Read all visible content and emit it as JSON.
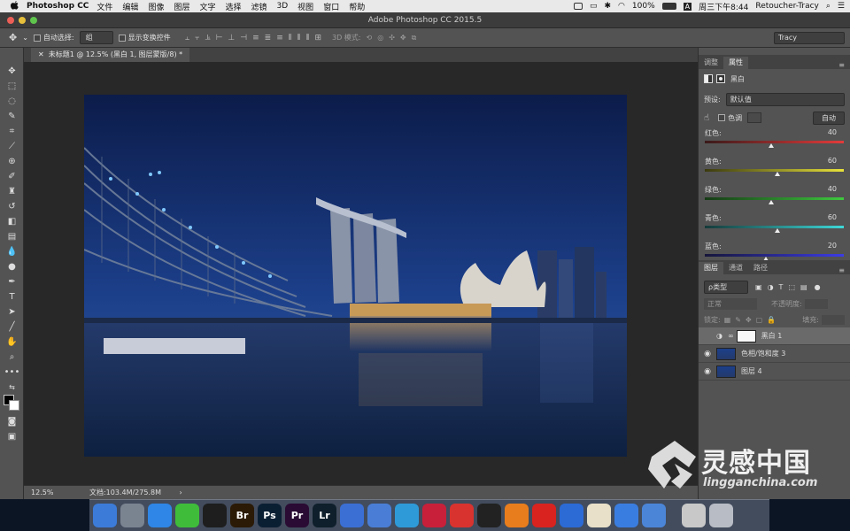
{
  "menubar": {
    "app_name": "Photoshop CC",
    "items": [
      "文件",
      "编辑",
      "图像",
      "图层",
      "文字",
      "选择",
      "滤镜",
      "3D",
      "视图",
      "窗口",
      "帮助"
    ],
    "battery": "100%",
    "input_method": "A",
    "datetime": "周三下午8:44",
    "user": "Retoucher-Tracy"
  },
  "window": {
    "title": "Adobe Photoshop CC 2015.5"
  },
  "options": {
    "auto_select_label": "自动选择:",
    "auto_select_value": "组",
    "show_transform_label": "显示变换控件",
    "mode_3d_label": "3D 模式:",
    "workspace": "Tracy"
  },
  "document": {
    "tab_title": "未标题1 @ 12.5% (黑白 1, 图层蒙版/8) *"
  },
  "status": {
    "zoom": "12.5%",
    "doc_info": "文档:103.4M/275.8M"
  },
  "properties": {
    "tabs": [
      "调整",
      "属性"
    ],
    "active_tab": "属性",
    "adjustment_name": "黑白",
    "preset_label": "预设:",
    "preset_value": "默认值",
    "tint_label": "色调",
    "auto_button": "自动",
    "sliders": [
      {
        "label": "红色:",
        "value": 40,
        "min": -200,
        "max": 300,
        "gradient": [
          "#3a1a1a",
          "#e33b3b"
        ]
      },
      {
        "label": "黄色:",
        "value": 60,
        "min": -200,
        "max": 300,
        "gradient": [
          "#3a3a10",
          "#e8e23a"
        ]
      },
      {
        "label": "绿色:",
        "value": 40,
        "min": -200,
        "max": 300,
        "gradient": [
          "#163a16",
          "#3ec83e"
        ]
      },
      {
        "label": "青色:",
        "value": 60,
        "min": -200,
        "max": 300,
        "gradient": [
          "#163a3a",
          "#3ed8d8"
        ]
      },
      {
        "label": "蓝色:",
        "value": 20,
        "min": -200,
        "max": 300,
        "gradient": [
          "#16163a",
          "#3c3ce6"
        ]
      }
    ]
  },
  "layers": {
    "tabs": [
      "图层",
      "通道",
      "路径"
    ],
    "active_tab": "图层",
    "filter_label": "ρ类型",
    "blend_mode": "正常",
    "opacity_label": "不透明度:",
    "lock_label": "锁定:",
    "fill_label": "填充:",
    "items": [
      {
        "name": "黑白 1",
        "selected": true,
        "visible": false
      },
      {
        "name": "色相/饱和度 3",
        "selected": false,
        "visible": true
      },
      {
        "name": "图层 4",
        "selected": false,
        "visible": true
      }
    ]
  },
  "watermark": {
    "cn": "灵感中国",
    "url": "lingganchina.com"
  },
  "dock": {
    "apps": [
      {
        "label": "",
        "color": "#3c7bd8",
        "icon": "finder-icon"
      },
      {
        "label": "",
        "color": "#7a8390",
        "icon": "launchpad-icon"
      },
      {
        "label": "",
        "color": "#2f86e6",
        "icon": "safari-icon"
      },
      {
        "label": "",
        "color": "#3fbd3a",
        "icon": "wechat-icon"
      },
      {
        "label": "",
        "color": "#1e1e1e",
        "icon": "qq-icon"
      },
      {
        "label": "Br",
        "color": "#2b1a06",
        "icon": "bridge-icon"
      },
      {
        "label": "Ps",
        "color": "#0b1f33",
        "icon": "photoshop-icon"
      },
      {
        "label": "Pr",
        "color": "#2a0b33",
        "icon": "premiere-icon"
      },
      {
        "label": "Lr",
        "color": "#0f1f2b",
        "icon": "lightroom-icon"
      },
      {
        "label": "",
        "color": "#3b6fd4",
        "icon": "cloud-icon"
      },
      {
        "label": "",
        "color": "#4a7ed6",
        "icon": "image-capture-icon"
      },
      {
        "label": "",
        "color": "#2f9ad8",
        "icon": "info-icon"
      },
      {
        "label": "",
        "color": "#c8203a",
        "icon": "davinci-icon"
      },
      {
        "label": "",
        "color": "#d8332f",
        "icon": "media-icon"
      },
      {
        "label": "",
        "color": "#222222",
        "icon": "obs-icon"
      },
      {
        "label": "",
        "color": "#e87d1e",
        "icon": "xiami-icon"
      },
      {
        "label": "",
        "color": "#d8231f",
        "icon": "netease-music-icon"
      },
      {
        "label": "",
        "color": "#2c6ad6",
        "icon": "browser-icon"
      },
      {
        "label": "",
        "color": "#e8e0c8",
        "icon": "preview-icon"
      },
      {
        "label": "",
        "color": "#3a7de0",
        "icon": "numbers-icon"
      },
      {
        "label": "",
        "color": "#4b85d8",
        "icon": "keynote-icon"
      },
      {
        "label": "",
        "color": "#c8c8c8",
        "icon": "disk-utility-icon"
      },
      {
        "label": "",
        "color": "#b8bcc4",
        "icon": "trash-icon"
      }
    ]
  }
}
